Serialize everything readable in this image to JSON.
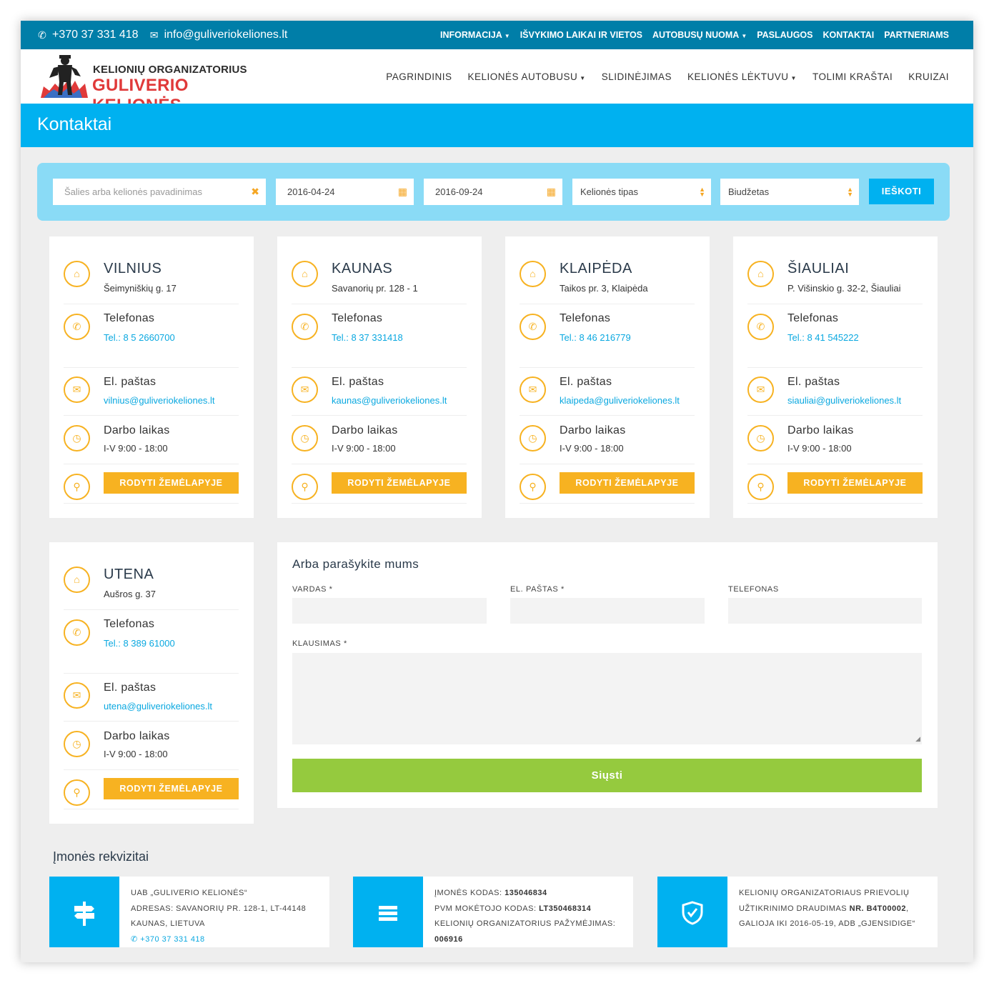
{
  "topbar": {
    "phone": "+370 37 331 418",
    "email": "info@guliveriokeliones.lt",
    "nav": [
      "INFORMACIJA",
      "IŠVYKIMO LAIKAI IR VIETOS",
      "AUTOBUSŲ NUOMA",
      "PASLAUGOS",
      "KONTAKTAI",
      "PARTNERIAMS"
    ]
  },
  "logo": {
    "line1": "KELIONIŲ ORGANIZATORIUS",
    "line2": "GULIVERIO KELIONĖS"
  },
  "mainnav": [
    "PAGRINDINIS",
    "KELIONĖS AUTOBUSU",
    "SLIDINĖJIMAS",
    "KELIONĖS LĖKTUVU",
    "TOLIMI KRAŠTAI",
    "KRUIZAI"
  ],
  "page_title": "Kontaktai",
  "search": {
    "placeholder": "Šalies arba kelionės pavadinimas",
    "date_from": "2016-04-24",
    "date_to": "2016-09-24",
    "type": "Kelionės tipas",
    "budget": "Biudžetas",
    "button": "IEŠKOTI"
  },
  "labels": {
    "phone": "Telefonas",
    "email": "El. paštas",
    "hours": "Darbo laikas",
    "map_button": "RODYTI ŽEMĖLAPYJE"
  },
  "offices": [
    {
      "city": "VILNIUS",
      "address": "Šeimyniškių g. 17",
      "phone": "Tel.: 8 5 2660700",
      "email": "vilnius@guliveriokeliones.lt",
      "hours": "I-V 9:00 - 18:00"
    },
    {
      "city": "KAUNAS",
      "address": "Savanorių pr. 128 - 1",
      "phone": "Tel.: 8 37 331418",
      "email": "kaunas@guliveriokeliones.lt",
      "hours": "I-V 9:00 - 18:00"
    },
    {
      "city": "KLAIPĖDA",
      "address": "Taikos pr. 3, Klaipėda",
      "phone": "Tel.: 8 46 216779",
      "email": "klaipeda@guliveriokeliones.lt",
      "hours": "I-V 9:00 - 18:00"
    },
    {
      "city": "ŠIAULIAI",
      "address": "P. Višinskio g. 32-2, Šiauliai",
      "phone": "Tel.: 8 41 545222",
      "email": "siauliai@guliveriokeliones.lt",
      "hours": "I-V 9:00 - 18:00"
    },
    {
      "city": "UTENA",
      "address": "Aušros g. 37",
      "phone": "Tel.: 8 389 61000",
      "email": "utena@guliveriokeliones.lt",
      "hours": "I-V 9:00 - 18:00"
    }
  ],
  "form": {
    "title": "Arba parašykite mums",
    "name_label": "VARDAS *",
    "email_label": "EL. PAŠTAS *",
    "phone_label": "TELEFONAS",
    "question_label": "KLAUSIMAS *",
    "submit": "Siųsti"
  },
  "requisites": {
    "title": "Įmonės rekvizitai",
    "box1": {
      "name": "UAB „GULIVERIO KELIONĖS“",
      "address": "ADRESAS: SAVANORIŲ PR. 128-1, LT-44148",
      "city": "KAUNAS, LIETUVA",
      "phone": "+370 37 331 418"
    },
    "box2": {
      "code_label": "ĮMONĖS KODAS:",
      "code": "135046834",
      "vat_label": "PVM MOKĖTOJO KODAS:",
      "vat": "LT350468314",
      "cert_label": "KELIONIŲ ORGANIZATORIUS PAŽYMĖJIMAS:",
      "cert": "006916"
    },
    "box3": {
      "line1": "KELIONIŲ ORGANIZATORIAUS PRIEVOLIŲ",
      "line2a": "UŽTIKRINIMO DRAUDIMAS",
      "policy": "NR. B4T00002",
      "line2b": ",",
      "line3": "GALIOJA IKI 2016-05-19, ADB „GJENSIDIGE“"
    }
  },
  "colors": {
    "topbar": "#007ea8",
    "accent": "#00b1f0",
    "orange": "#f7b221",
    "green": "#95ca3e",
    "logo_red": "#e03a3a"
  }
}
